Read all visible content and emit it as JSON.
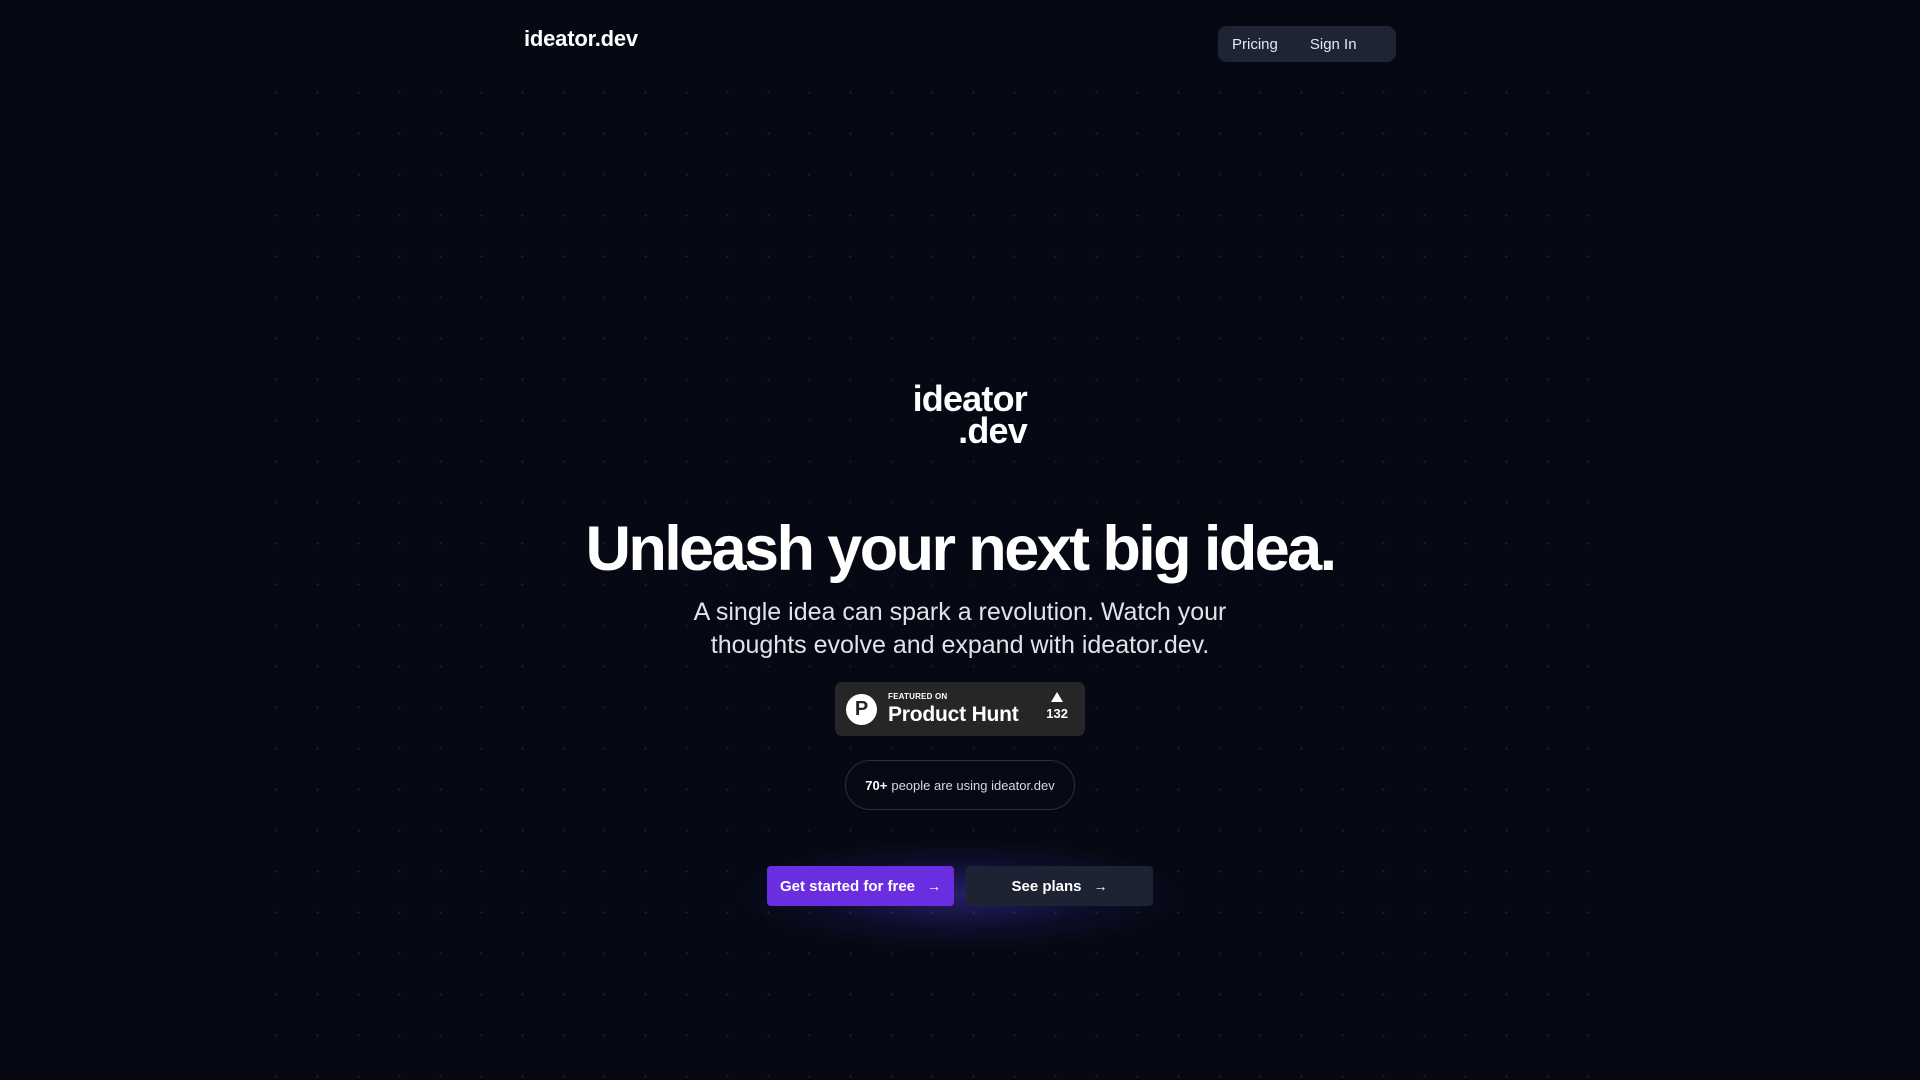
{
  "header": {
    "brand": "ideator.dev",
    "nav": {
      "pricing": "Pricing",
      "sign_in": "Sign In"
    }
  },
  "hero": {
    "logo_line1": "ideator",
    "logo_line2": ".dev",
    "headline": "Unleash your next big idea.",
    "subtitle": "A single idea can spark a revolution. Watch your thoughts evolve and expand with ideator.dev."
  },
  "product_hunt_badge": {
    "featured_label": "FEATURED ON",
    "name": "Product Hunt",
    "logo_letter": "P",
    "upvote_count": "132"
  },
  "users_pill": {
    "count": "70+",
    "text": "people are using ideator.dev"
  },
  "cta": {
    "primary_label": "Get started for free",
    "secondary_label": "See plans",
    "arrow": "→"
  },
  "colors": {
    "background": "#060913",
    "primary_button": "#6a2ee0",
    "secondary_button": "#1d2333",
    "nav_background": "#1e2433",
    "badge_background": "#262626"
  }
}
